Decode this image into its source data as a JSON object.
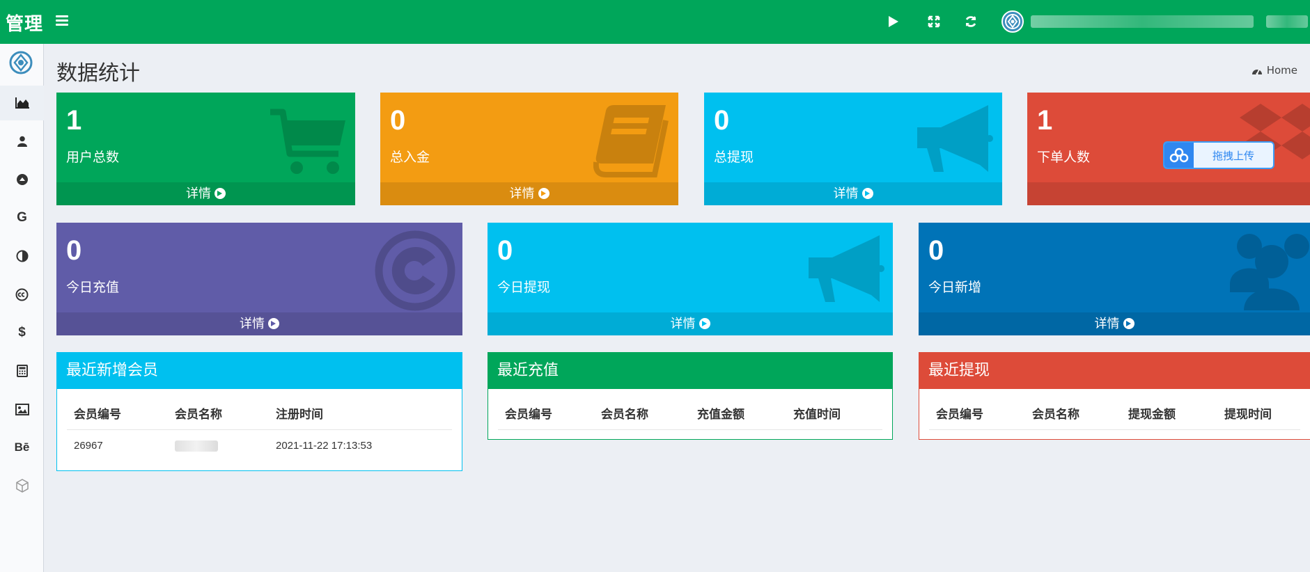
{
  "topbar": {
    "logo": "管理",
    "color": "#00a65a"
  },
  "breadcrumb": {
    "home": "Home"
  },
  "page": {
    "title": "数据统计"
  },
  "stats_row1": [
    {
      "value": "1",
      "label": "用户总数",
      "more": "详情",
      "color": "#00a65a",
      "icon": "shopping-cart-icon"
    },
    {
      "value": "0",
      "label": "总入金",
      "more": "详情",
      "color": "#f39c12",
      "icon": "book-icon"
    },
    {
      "value": "0",
      "label": "总提现",
      "more": "详情",
      "color": "#00c0ef",
      "icon": "bullhorn-icon"
    },
    {
      "value": "1",
      "label": "下单人数",
      "more": "",
      "color": "#dd4b39",
      "icon": "dropbox-icon"
    }
  ],
  "stats_row2": [
    {
      "value": "0",
      "label": "今日充值",
      "more": "详情",
      "color": "#605ca8",
      "icon": "coin-icon"
    },
    {
      "value": "0",
      "label": "今日提现",
      "more": "详情",
      "color": "#00c0ef",
      "icon": "bullhorn-icon"
    },
    {
      "value": "0",
      "label": "今日新增",
      "more": "详情",
      "color": "#0073b7",
      "icon": "users-icon"
    }
  ],
  "upload": {
    "label": "拖拽上传"
  },
  "panels": {
    "members": {
      "title": "最近新增会员",
      "color": "#00c0ef",
      "columns": [
        "会员编号",
        "会员名称",
        "注册时间"
      ],
      "rows": [
        {
          "id": "26967",
          "time": "2021-11-22 17:13:53"
        }
      ]
    },
    "recharge": {
      "title": "最近充值",
      "color": "#00a65a",
      "columns": [
        "会员编号",
        "会员名称",
        "充值金额",
        "充值时间"
      ]
    },
    "withdraw": {
      "title": "最近提现",
      "color": "#dd4b39",
      "columns": [
        "会员编号",
        "会员名称",
        "提现金额",
        "提现时间"
      ]
    }
  },
  "sidebar": {
    "items": [
      {
        "icon": "area-chart-icon"
      },
      {
        "icon": "user-icon"
      },
      {
        "icon": "arrow-circle-up-icon"
      },
      {
        "icon": "google-icon",
        "text": "G"
      },
      {
        "icon": "adjust-icon"
      },
      {
        "icon": "creative-commons-icon"
      },
      {
        "icon": "dollar-icon",
        "text": "$"
      },
      {
        "icon": "calculator-icon"
      },
      {
        "icon": "image-icon"
      },
      {
        "icon": "behance-icon",
        "text": "Bē"
      },
      {
        "icon": "cube-icon"
      }
    ]
  }
}
